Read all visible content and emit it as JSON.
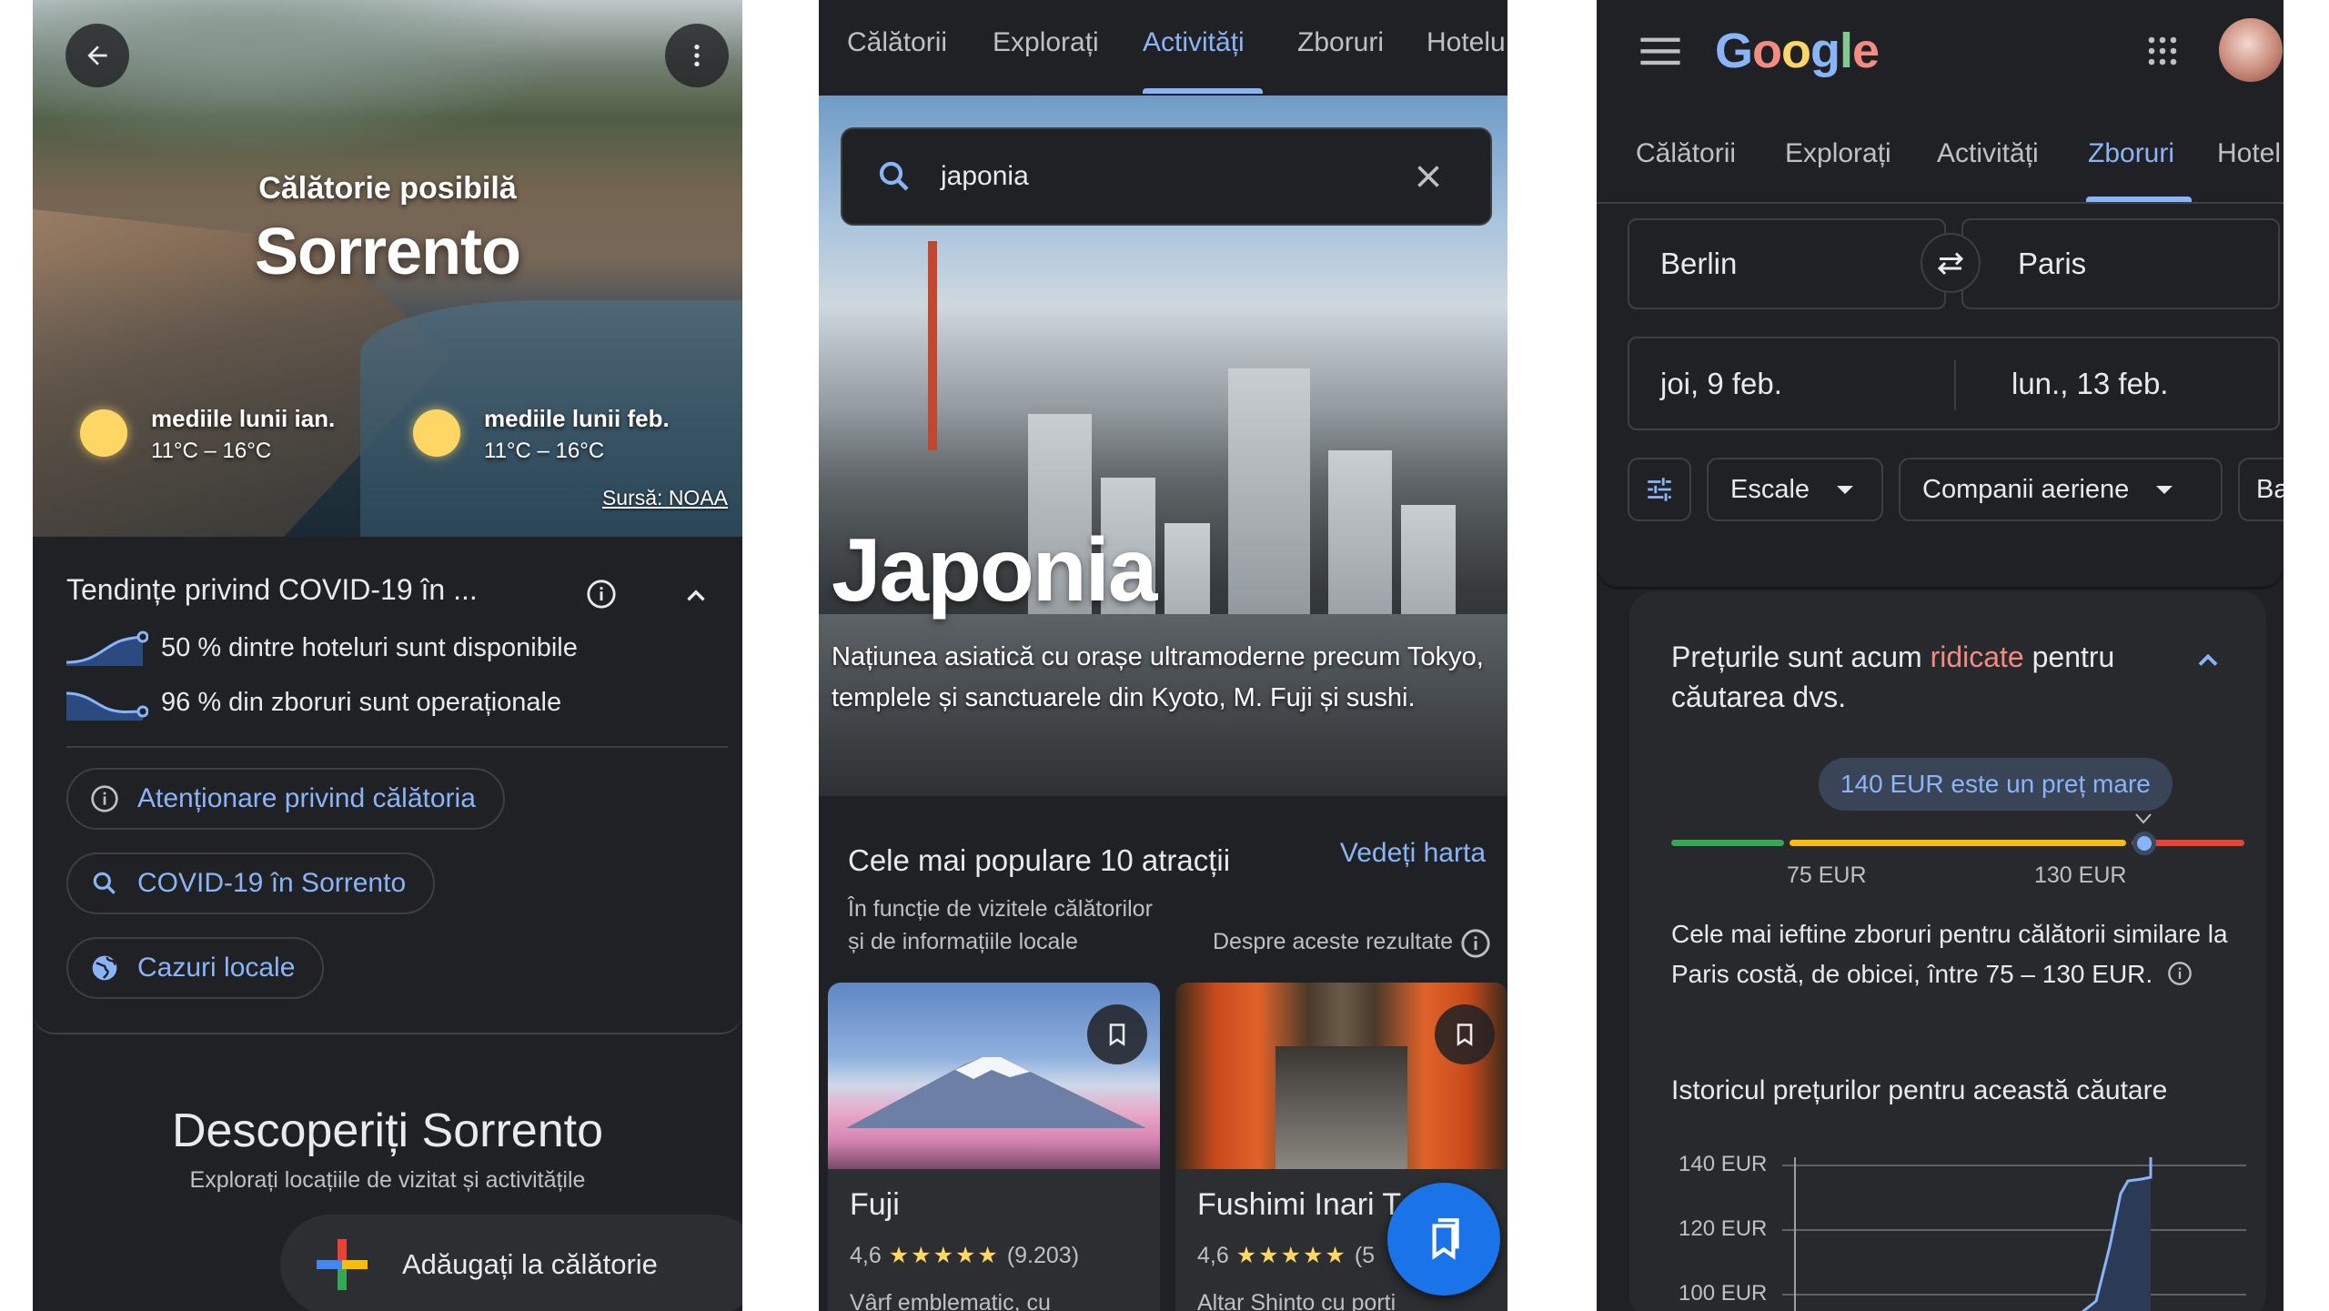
{
  "panel1": {
    "back_icon": "arrow-left-icon",
    "more_icon": "more-vert-icon",
    "hero_subtitle": "Călătorie posibilă",
    "hero_title": "Sorrento",
    "weather": [
      {
        "label": "mediile lunii ian.",
        "temp": "11°C – 16°C",
        "icon": "sun-icon"
      },
      {
        "label": "mediile lunii feb.",
        "temp": "11°C – 16°C",
        "icon": "sun-icon"
      }
    ],
    "source": "Sursă: NOAA",
    "covid": {
      "title": "Tendințe privind COVID-19 în ...",
      "trends": [
        {
          "text": "50 % dintre hoteluri sunt disponibile",
          "icon": "trend-up-icon"
        },
        {
          "text": "96 % din zboruri sunt operaționale",
          "icon": "trend-down-icon"
        }
      ],
      "chips": [
        {
          "label": "Atenționare privind călătoria",
          "icon": "info-icon"
        },
        {
          "label": "COVID-19 în Sorrento",
          "icon": "search-icon"
        },
        {
          "label": "Cazuri locale",
          "icon": "globe-icon"
        }
      ]
    },
    "discover_title": "Descoperiți Sorrento",
    "discover_subtitle": "Explorați locațiile de vizitat și activitățile",
    "add_trip_label": "Adăugați la călătorie"
  },
  "panel2": {
    "tabs": [
      "Călătorii",
      "Explorați",
      "Activități",
      "Zboruri",
      "Hotelu"
    ],
    "active_tab": "Activități",
    "search_value": "japonia",
    "hero_title": "Japonia",
    "hero_description": "Națiunea asiatică cu orașe ultramoderne precum Tokyo, templele și sanctuarele din Kyoto, M. Fuji și sushi.",
    "attractions_title": "Cele mai populare 10 atracții",
    "map_link": "Vedeți harta",
    "attractions_subtitle_1": "În funcție de vizitele călătorilor",
    "attractions_subtitle_2": "și de informațiile locale",
    "about_results": "Despre aceste rezultate",
    "places": [
      {
        "name": "Fuji",
        "rating": "4,6",
        "stars": "★★★★★",
        "reviews": "(9.203)",
        "desc": "Vârf emblematic, cu"
      },
      {
        "name": "Fushimi Inari T",
        "rating": "4,6",
        "stars": "★★★★★",
        "reviews": "(5",
        "desc": "Altar Shinto cu porți"
      }
    ]
  },
  "panel3": {
    "logo": "Google",
    "tabs": [
      "Călătorii",
      "Explorați",
      "Activități",
      "Zboruri",
      "Hotel"
    ],
    "active_tab": "Zboruri",
    "origin": "Berlin",
    "destination": "Paris",
    "depart_date": "joi, 9 feb.",
    "return_date": "lun., 13 feb.",
    "filters": [
      "Escale",
      "Companii aeriene",
      "Ba"
    ],
    "insight_title_prefix": "Prețurile sunt acum ",
    "insight_title_highlight": "ridicate",
    "insight_title_suffix": " pentru căutarea dvs.",
    "price_badge": "140 EUR este un preț mare",
    "range_low": "75 EUR",
    "range_high": "130 EUR",
    "insight_text": "Cele mai ieftine zboruri pentru călătorii similare la Paris costă, de obicei, între 75 – 130 EUR.",
    "history_title": "Istoricul prețurilor pentru această căutare",
    "history_ylabels": [
      "140 EUR",
      "120 EUR",
      "100 EUR"
    ],
    "colors": {
      "low": "#34a853",
      "typical": "#fbbc04",
      "high": "#ea4335",
      "accent": "#8ab4f8"
    }
  }
}
